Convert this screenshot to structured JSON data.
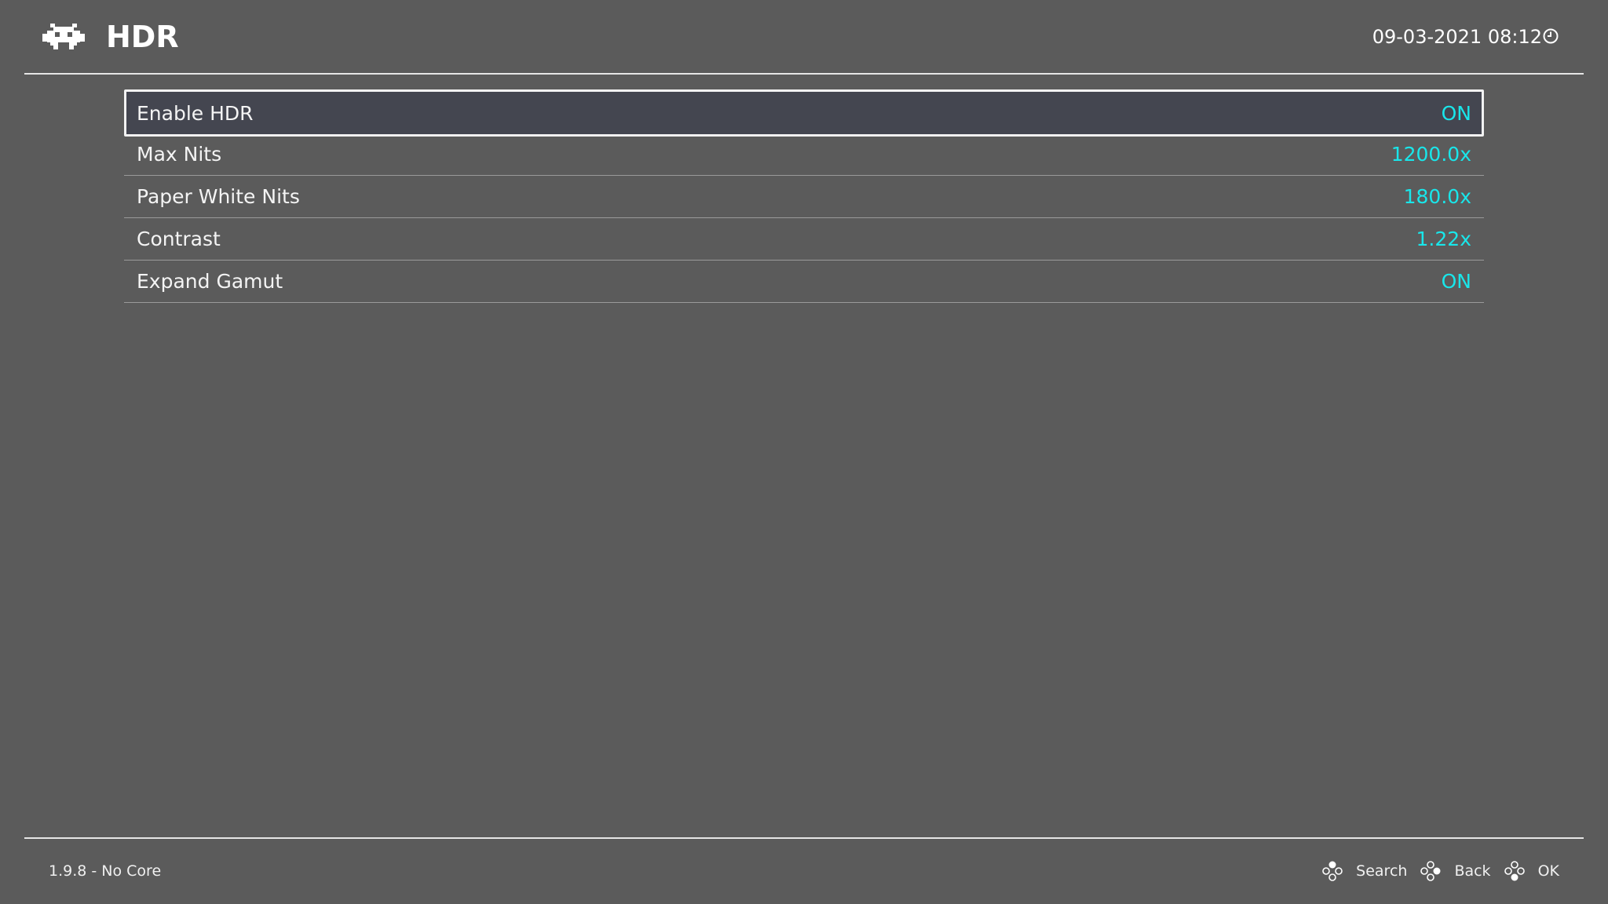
{
  "header": {
    "title": "HDR",
    "datetime": "09-03-2021 08:12",
    "logo_icon": "retroarch-invader-icon",
    "clock_icon": "clock-icon"
  },
  "settings": {
    "items": [
      {
        "label": "Enable HDR",
        "value": "ON",
        "selected": true
      },
      {
        "label": "Max Nits",
        "value": "1200.0x"
      },
      {
        "label": "Paper White Nits",
        "value": "180.0x"
      },
      {
        "label": "Contrast",
        "value": "1.22x"
      },
      {
        "label": "Expand Gamut",
        "value": "ON"
      }
    ]
  },
  "footer": {
    "version": "1.9.8 - No Core",
    "hints": [
      {
        "label": "Search",
        "icon": "gamepad-buttons-top-icon"
      },
      {
        "label": "Back",
        "icon": "gamepad-buttons-right-icon"
      },
      {
        "label": "OK",
        "icon": "gamepad-buttons-bottom-icon"
      }
    ]
  },
  "colors": {
    "background": "#5b5b5b",
    "value_accent": "#19e6ea",
    "selection_bg": "#444650"
  }
}
